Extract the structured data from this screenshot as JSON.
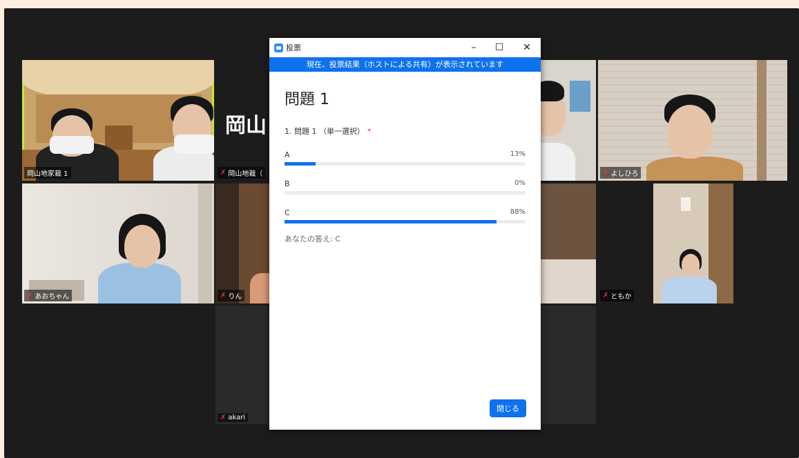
{
  "poll": {
    "window_title": "投票",
    "banner": "現在、投票結果（ホストによる共有）が表示されています",
    "question_title": "問題 1",
    "question_label": "1. 問題 1 （単一選択）",
    "required_mark": "*",
    "options": [
      {
        "label": "A",
        "percent_text": "13%",
        "percent": 13
      },
      {
        "label": "B",
        "percent_text": "0%",
        "percent": 0
      },
      {
        "label": "C",
        "percent_text": "88%",
        "percent": 88
      }
    ],
    "your_answer": "あなたの答え: C",
    "close_label": "閉じる"
  },
  "window_controls": {
    "minimize": "–",
    "maximize": "☐",
    "close": "✕"
  },
  "participants": {
    "host": "岡山地家裁 1",
    "second": "岡山地裁（",
    "second_title": "岡山",
    "yoshihiro": "よしひろ",
    "aochan": "あおちゃん",
    "rin": "りん",
    "tomoka": "ともか",
    "akari": "akari"
  },
  "colors": {
    "accent": "#0e72ed",
    "active_speaker": "#c3e83a",
    "mic_muted": "#e53935"
  }
}
